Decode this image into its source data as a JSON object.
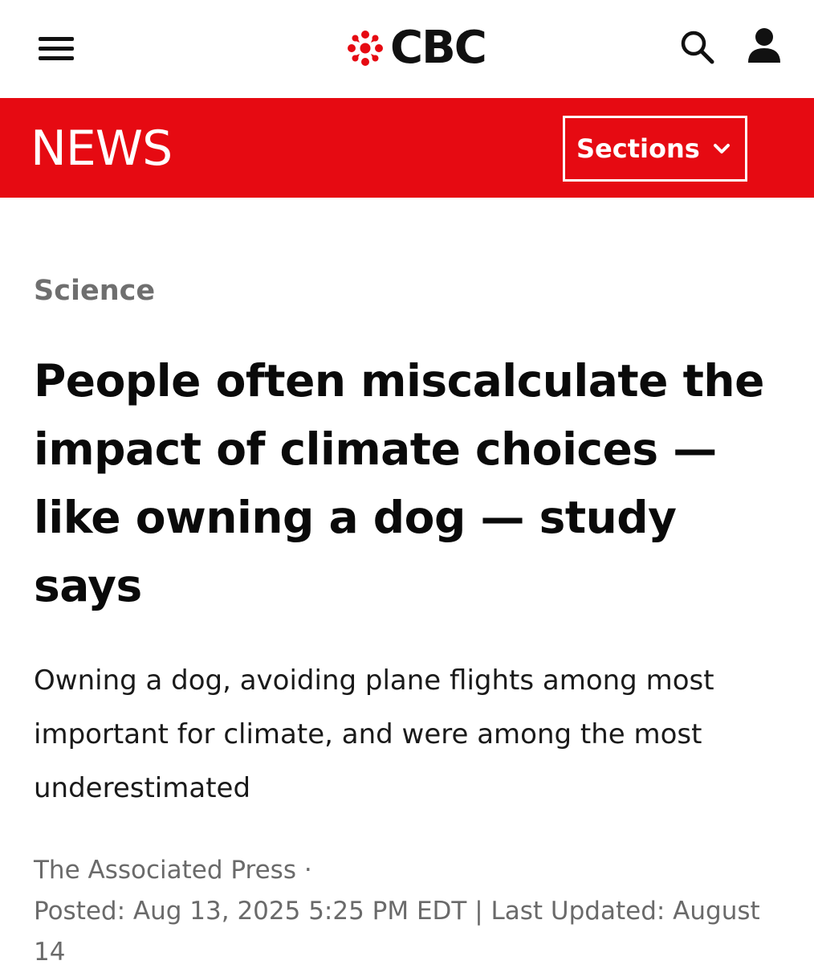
{
  "header": {
    "logo_text": "CBC",
    "menu_icon": "hamburger-menu-icon",
    "search_icon": "search-icon",
    "account_icon": "user-icon",
    "brand_color": "#e60a12"
  },
  "newsbar": {
    "label": "NEWS",
    "sections_label": "Sections",
    "sections_icon": "chevron-down-icon"
  },
  "article": {
    "section": "Science",
    "headline": "People often miscalculate the impact of climate choices — like owning a dog — study says",
    "deck": "Owning a dog, avoiding plane flights among most important for climate, and were among the most underestimated",
    "author": "The Associated Press",
    "separator": "·",
    "dates": "Posted: Aug 13, 2025 5:25 PM EDT | Last Updated: August 14"
  }
}
